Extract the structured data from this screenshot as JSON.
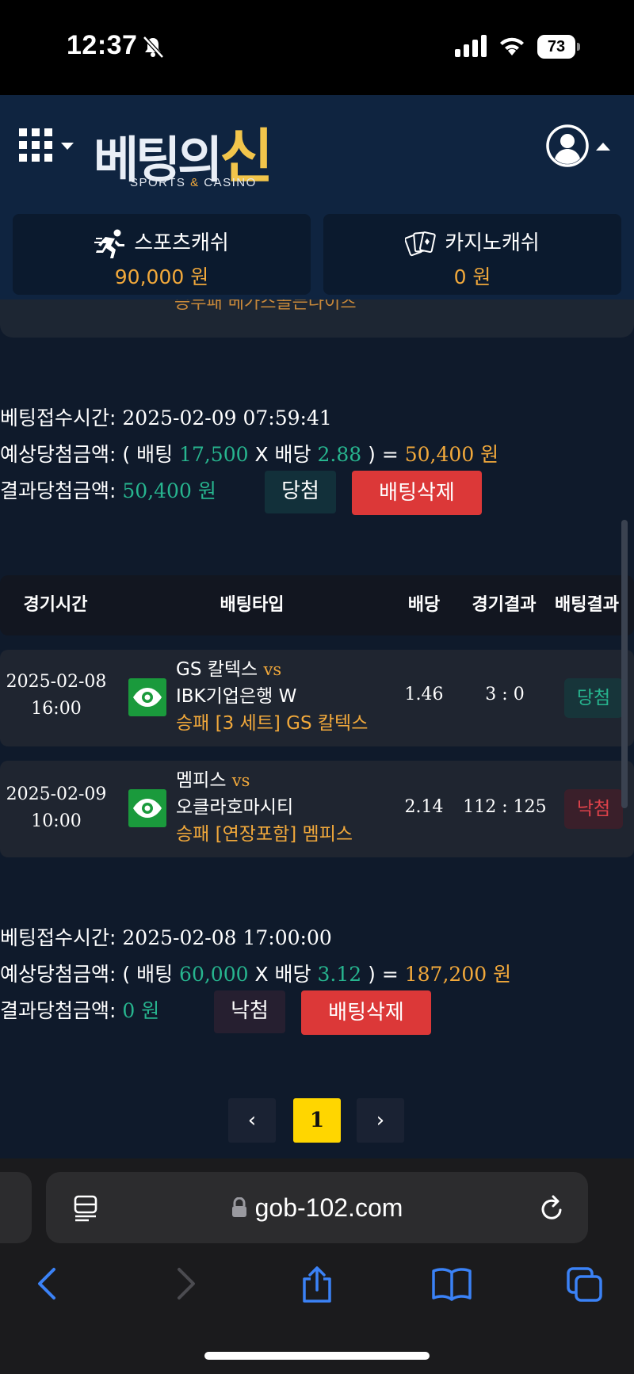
{
  "status_bar": {
    "time": "12:37",
    "battery": "73"
  },
  "header": {
    "logo_main": "베팅의",
    "logo_accent": "신",
    "logo_sub_a": "SPORTS ",
    "logo_sub_amp": "&",
    "logo_sub_b": " CASINO"
  },
  "wallets": [
    {
      "label": "스포츠캐쉬",
      "value": "90,000 원",
      "icon": "runner-icon"
    },
    {
      "label": "카지노캐쉬",
      "value": "0 원",
      "icon": "cards-icon"
    }
  ],
  "cut_text": "승무패 베가스골든나이츠",
  "bets": [
    {
      "time_label": "베팅접수시간:",
      "time_value": "2025-02-09 07:59:41",
      "expect_label": "예상당첨금액:",
      "open": "( 배팅",
      "stake": "17,500",
      "mult": "X 배당",
      "odds": "2.88",
      "close": ") =",
      "payout": "50,400 원",
      "result_label": "결과당첨금액:",
      "result_value": "50,400 원",
      "status": "당첨",
      "delete_label": "배팅삭제"
    },
    {
      "time_label": "베팅접수시간:",
      "time_value": "2025-02-08 17:00:00",
      "expect_label": "예상당첨금액:",
      "open": "( 배팅",
      "stake": "60,000",
      "mult": "X 배당",
      "odds": "3.12",
      "close": ") =",
      "payout": "187,200 원",
      "result_label": "결과당첨금액:",
      "result_value": "0 원",
      "status": "낙첨",
      "delete_label": "배팅삭제"
    }
  ],
  "table": {
    "headers": [
      "경기시간",
      "배팅타입",
      "배당",
      "경기결과",
      "배팅결과"
    ],
    "rows": [
      {
        "date": "2025-02-08",
        "time": "16:00",
        "home": "GS 칼텍스",
        "vs": "vs",
        "away": "IBK기업은행 W",
        "pick": "승패 [3 세트] GS 칼텍스",
        "odds": "1.46",
        "score": "3 : 0",
        "result": "당첨"
      },
      {
        "date": "2025-02-09",
        "time": "10:00",
        "home": "멤피스",
        "vs": "vs",
        "away": "오클라호마시티",
        "pick": "승패 [연장포함] 멤피스",
        "odds": "2.14",
        "score": "112 : 125",
        "result": "낙첨"
      }
    ]
  },
  "pagination": {
    "prev": "‹",
    "current": "1",
    "next": "›"
  },
  "browser": {
    "url": "gob-102.com"
  },
  "colors": {
    "accent_green": "#27b58f",
    "accent_orange": "#f2a93b",
    "delete_red": "#dc3838",
    "page_yellow": "#ffd600"
  }
}
